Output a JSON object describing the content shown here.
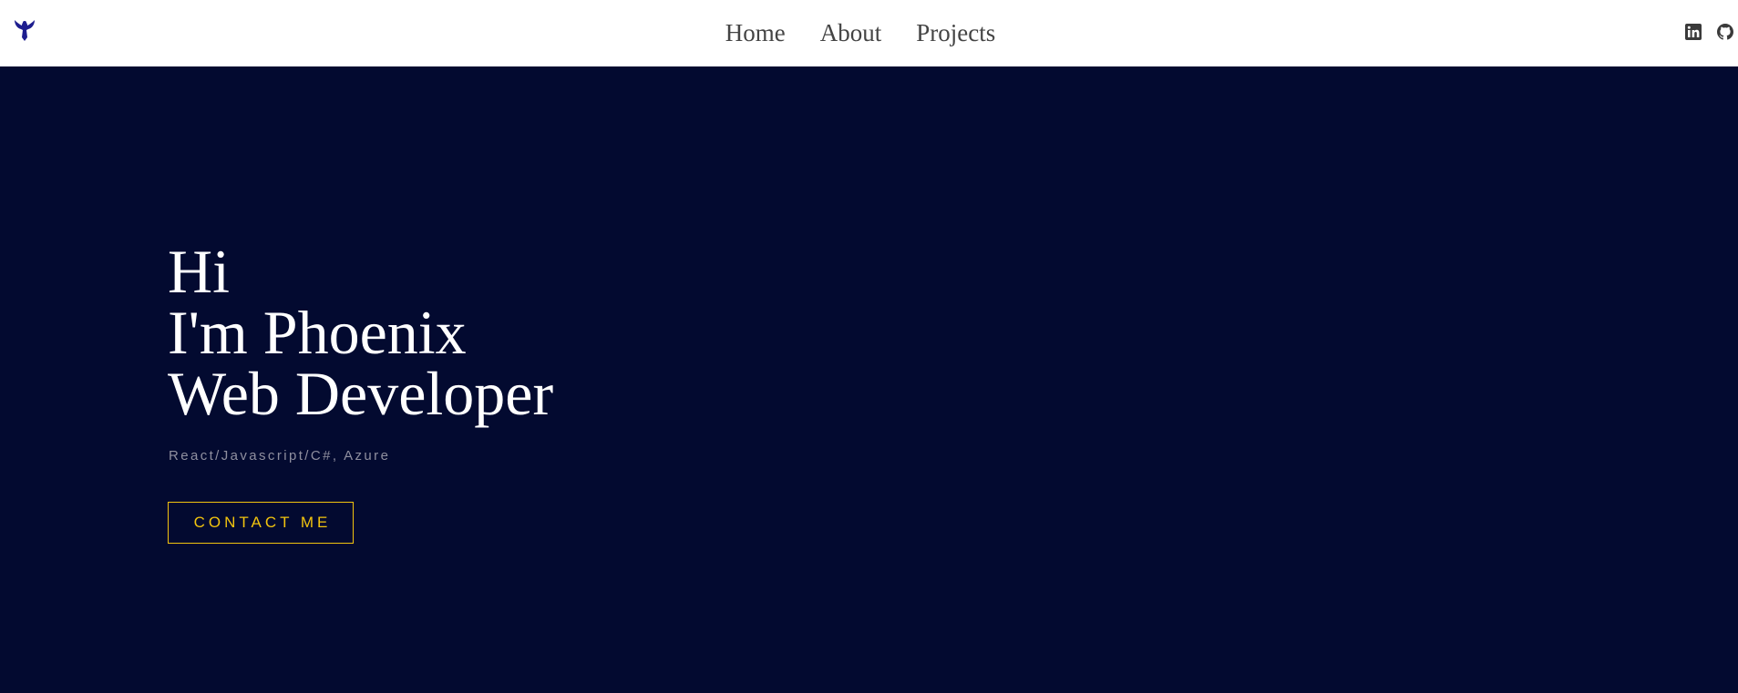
{
  "nav": {
    "logo_icon": "phoenix-logo-icon",
    "logo_color": "#1e1e8f",
    "links": [
      {
        "label": "Home"
      },
      {
        "label": "About"
      },
      {
        "label": "Projects"
      }
    ],
    "social": [
      {
        "icon": "linkedin-icon"
      },
      {
        "icon": "github-icon"
      }
    ]
  },
  "hero": {
    "greeting": "Hi",
    "name_line": "I'm Phoenix",
    "role_line": "Web Developer",
    "skills": "React/Javascript/C#, Azure",
    "cta_label": "CONTACT ME",
    "background_color": "#030a30",
    "accent_color": "#f2c40e"
  }
}
